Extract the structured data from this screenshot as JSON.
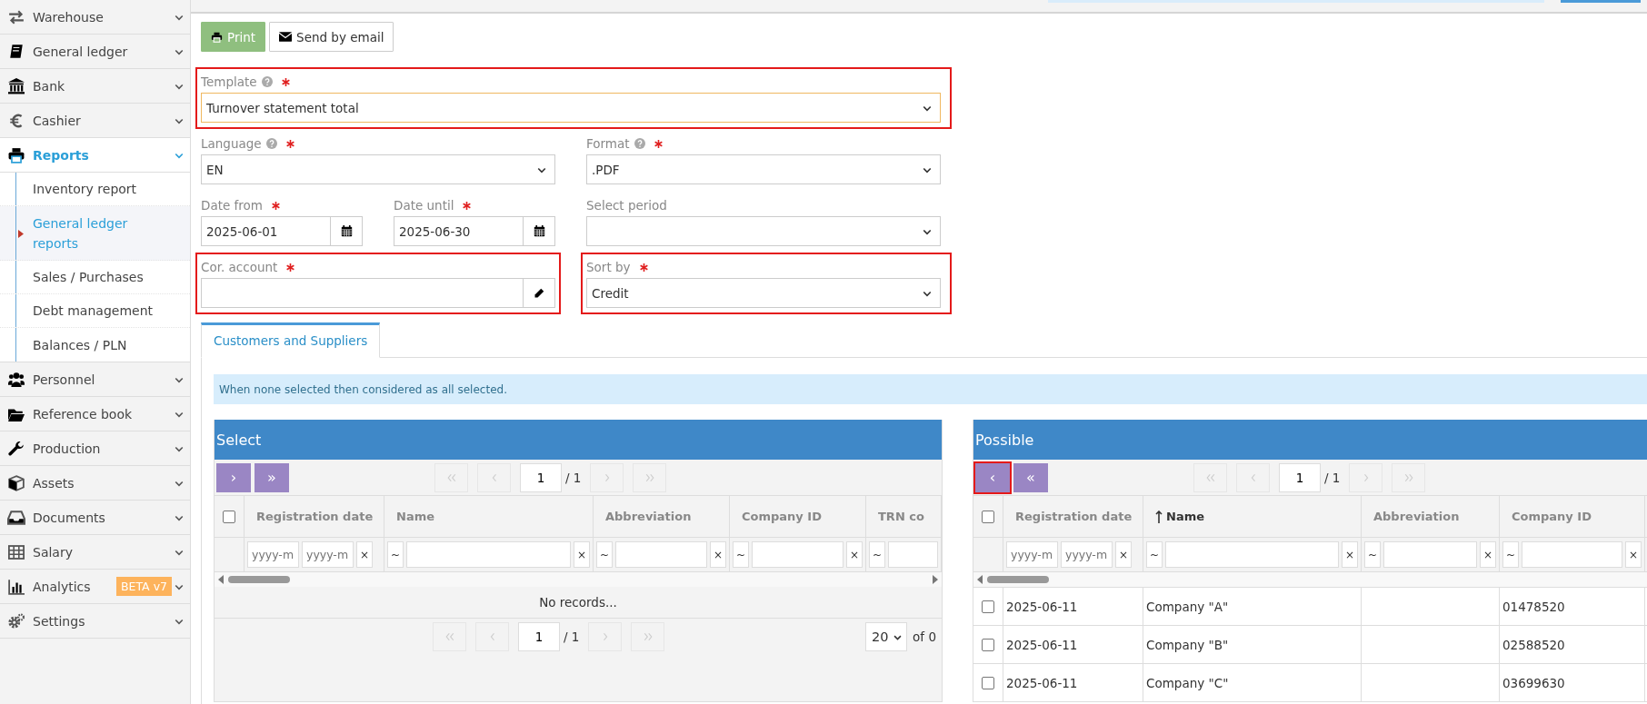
{
  "sidebar": {
    "items": [
      {
        "label": "Warehouse",
        "selected": false
      },
      {
        "label": "General ledger",
        "selected": false
      },
      {
        "label": "Bank",
        "selected": false
      },
      {
        "label": "Cashier",
        "selected": false
      },
      {
        "label": "Reports",
        "selected": true,
        "expanded": true,
        "children": [
          {
            "label": "Inventory report",
            "selected": false
          },
          {
            "label": "General ledger reports",
            "selected": true
          },
          {
            "label": "Sales / Purchases",
            "selected": false
          },
          {
            "label": "Debt management",
            "selected": false
          },
          {
            "label": "Balances / PLN",
            "selected": false
          }
        ]
      },
      {
        "label": "Personnel",
        "selected": false
      },
      {
        "label": "Reference book",
        "selected": false
      },
      {
        "label": "Production",
        "selected": false
      },
      {
        "label": "Assets",
        "selected": false
      },
      {
        "label": "Documents",
        "selected": false
      },
      {
        "label": "Salary",
        "selected": false
      },
      {
        "label": "Analytics",
        "selected": false,
        "badge": "BETA v7"
      },
      {
        "label": "Settings",
        "selected": false
      }
    ]
  },
  "toolbar": {
    "buttons": [
      {
        "label": "Print",
        "kind": "primary"
      },
      {
        "label": "Send by email",
        "kind": "email"
      }
    ]
  },
  "form": {
    "rows": [
      {
        "fields": [
          {
            "kind": "select",
            "label": "Template",
            "help": true,
            "required": true,
            "value": "Turnover statement total",
            "focused": true,
            "highlighted": true
          }
        ]
      },
      {
        "fields": [
          {
            "kind": "select",
            "label": "Language",
            "help": true,
            "required": true,
            "value": "EN",
            "focused": false,
            "highlighted": false
          },
          {
            "kind": "select",
            "label": "Format",
            "help": true,
            "required": true,
            "value": ".PDF",
            "focused": false,
            "highlighted": false
          }
        ]
      },
      {
        "fields": [
          {
            "kind": "date",
            "label": "Date from",
            "required": true,
            "value": "2025-06-01",
            "focused": false,
            "highlighted": false
          },
          {
            "kind": "date",
            "label": "Date until",
            "required": true,
            "value": "2025-06-30",
            "focused": false,
            "highlighted": false
          },
          {
            "kind": "select",
            "label": "Select period",
            "focused": false,
            "highlighted": false
          }
        ]
      },
      {
        "fields": [
          {
            "kind": "lookup",
            "label": "Cor. account",
            "required": true,
            "focused": false,
            "highlighted": true
          },
          {
            "kind": "select",
            "label": "Sort by",
            "required": true,
            "value": "Credit",
            "focused": false,
            "highlighted": true
          }
        ]
      }
    ]
  },
  "tabs": [
    {
      "label": "Customers and Suppliers",
      "selected": true
    }
  ],
  "info": "When none selected then considered as all selected.",
  "panels": [
    {
      "title": "Select",
      "actions": [
        {
          "label": "›",
          "highlighted": false
        },
        {
          "label": "»",
          "highlighted": false
        }
      ],
      "pager": {
        "page": "1",
        "total": "/ 1"
      },
      "all_checked": false,
      "columns": [
        {
          "label": "Registration date",
          "sorted": false,
          "filter": {
            "kind": "date",
            "placeholders": [
              "yyyy-m",
              "yyyy-m"
            ],
            "clear": "×"
          }
        },
        {
          "label": "Name",
          "sorted": false,
          "filter": {
            "kind": "text",
            "operator": "~",
            "clear": "×"
          }
        },
        {
          "label": "Abbreviation",
          "sorted": false,
          "filter": {
            "kind": "text",
            "operator": "~",
            "clear": "×"
          }
        },
        {
          "label": "Company ID",
          "sorted": false,
          "filter": {
            "kind": "text",
            "operator": "~",
            "clear": "×"
          }
        },
        {
          "label": "TRN co",
          "sorted": false,
          "filter": {
            "kind": "text",
            "operator": "~"
          }
        }
      ],
      "empty_text": "No records...",
      "footer": {
        "pager": {
          "page": "1",
          "total": "/ 1"
        },
        "page_size": "20",
        "count": "of 0"
      }
    },
    {
      "title": "Possible",
      "actions": [
        {
          "label": "‹",
          "highlighted": true
        },
        {
          "label": "«",
          "highlighted": false
        }
      ],
      "pager": {
        "page": "1",
        "total": "/ 1"
      },
      "all_checked": false,
      "columns": [
        {
          "label": "Registration date",
          "sorted": false,
          "filter": {
            "kind": "date",
            "placeholders": [
              "yyyy-m",
              "yyyy-m"
            ],
            "clear": "×"
          }
        },
        {
          "label": "Name",
          "sorted": true,
          "filter": {
            "kind": "text",
            "operator": "~",
            "clear": "×"
          }
        },
        {
          "label": "Abbreviation",
          "sorted": false,
          "filter": {
            "kind": "text",
            "operator": "~",
            "clear": "×"
          }
        },
        {
          "label": "Company ID",
          "sorted": false,
          "filter": {
            "kind": "text",
            "operator": "~",
            "clear": "×"
          }
        }
      ],
      "rows": [
        {
          "checked": false,
          "cells": [
            "2025-06-11",
            "Company \"A\"",
            null,
            "01478520"
          ]
        },
        {
          "checked": false,
          "cells": [
            "2025-06-11",
            "Company \"B\"",
            null,
            "02588520"
          ]
        },
        {
          "checked": false,
          "cells": [
            "2025-06-11",
            "Company \"C\"",
            null,
            "03699630"
          ]
        }
      ]
    }
  ]
}
